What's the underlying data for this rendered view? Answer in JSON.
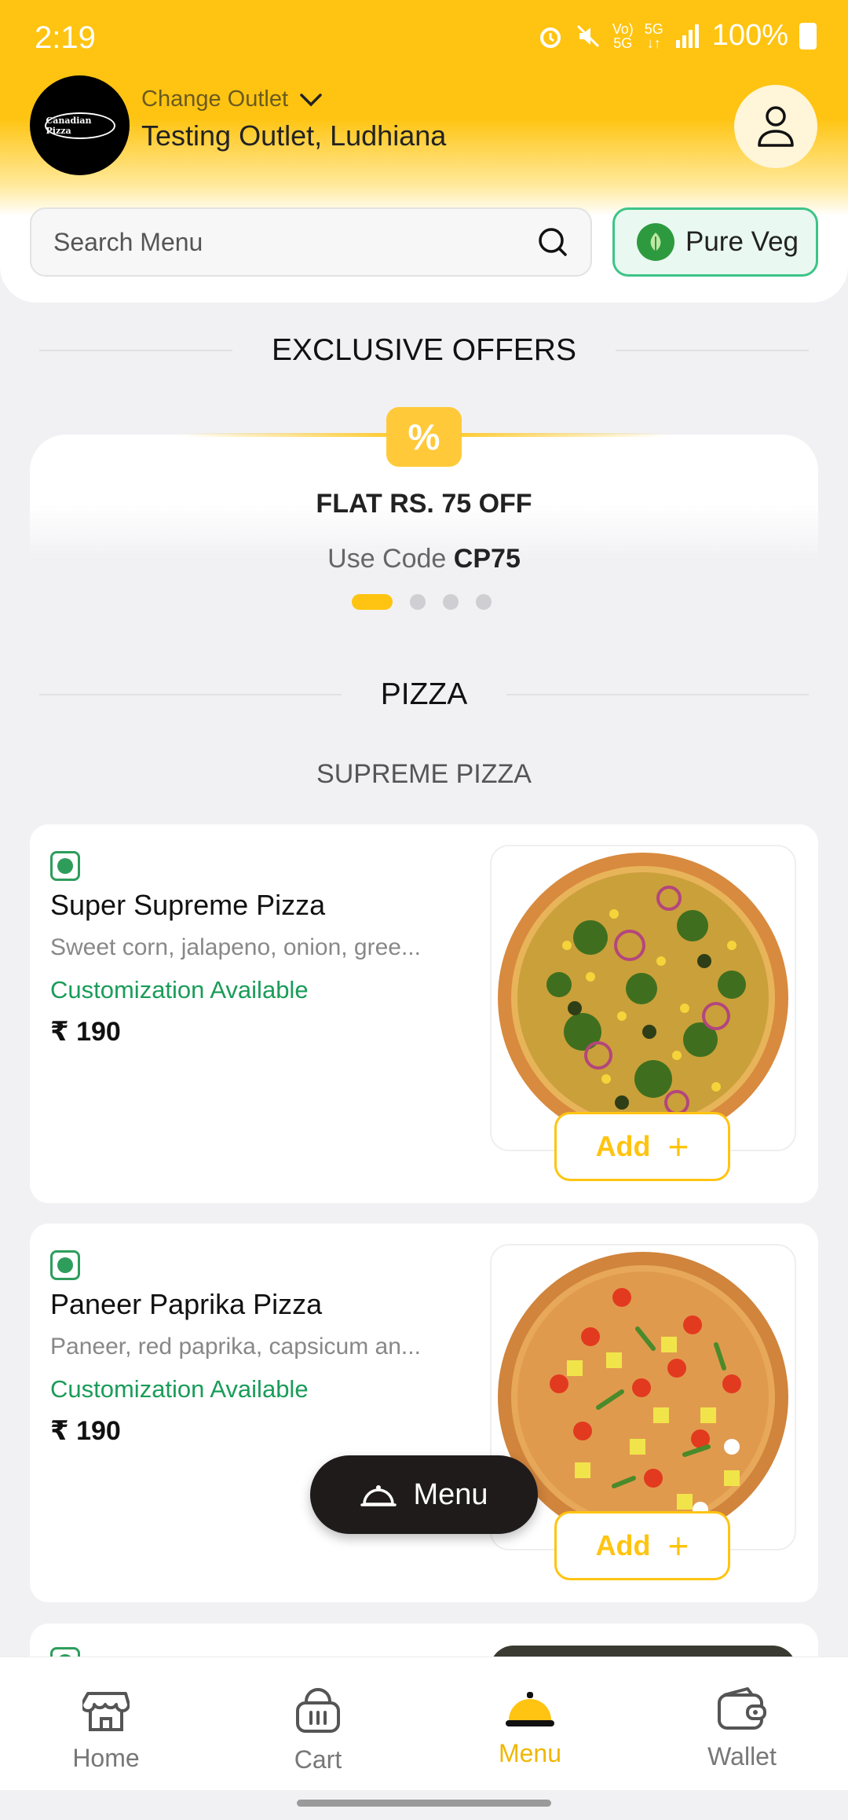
{
  "status_bar": {
    "time": "2:19",
    "volte": "Vo)",
    "net": "5G",
    "battery": "100%"
  },
  "header": {
    "change_outlet_label": "Change Outlet",
    "outlet_name": "Testing Outlet, Ludhiana",
    "logo_text": "Canadian Pizza"
  },
  "search": {
    "placeholder": "Search Menu"
  },
  "filter": {
    "pure_veg_label": "Pure Veg"
  },
  "offers": {
    "section_title": "EXCLUSIVE OFFERS",
    "badge_icon": "%",
    "title": "FLAT RS. 75 OFF",
    "code_prefix": "Use Code",
    "code": "CP75",
    "dots_total": 4,
    "active_dot": 0
  },
  "category": {
    "title": "PIZZA",
    "subcategory": "SUPREME PIZZA"
  },
  "items": [
    {
      "name": "Super Supreme Pizza",
      "description": "Sweet corn, jalapeno, onion, gree...",
      "customization": "Customization Available",
      "price": "₹ 190",
      "add_label": "Add"
    },
    {
      "name": "Paneer Paprika Pizza",
      "description": "Paneer, red paprika, capsicum an...",
      "customization": "Customization Available",
      "price": "₹ 190",
      "add_label": "Add"
    }
  ],
  "menu_fab": {
    "label": "Menu"
  },
  "bottom_nav": [
    {
      "label": "Home",
      "icon": "store-icon",
      "active": false
    },
    {
      "label": "Cart",
      "icon": "basket-icon",
      "active": false
    },
    {
      "label": "Menu",
      "icon": "cloche-icon",
      "active": true
    },
    {
      "label": "Wallet",
      "icon": "wallet-icon",
      "active": false
    }
  ],
  "colors": {
    "accent": "#ffc411",
    "veg_green": "#2e9d5b",
    "customization_green": "#1a9c59"
  }
}
